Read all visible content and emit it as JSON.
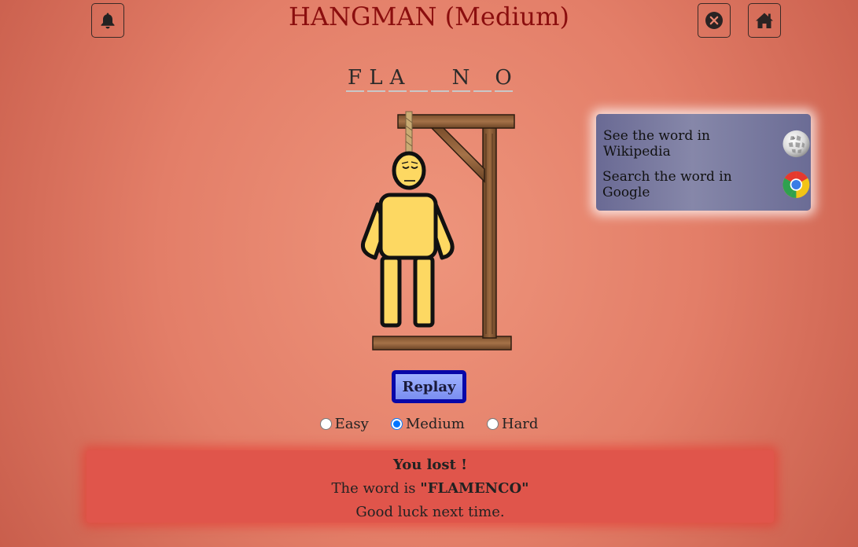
{
  "header": {
    "title": "HANGMAN (Medium)",
    "bell_icon": "bell-icon",
    "close_icon": "close-circle-icon",
    "home_icon": "home-icon"
  },
  "word_slots": [
    "F",
    "L",
    "A",
    "",
    "",
    "N",
    "",
    "O"
  ],
  "links": {
    "wikipedia_label": "See the word in Wikipedia",
    "wikipedia_icon": "wikipedia-globe-icon",
    "google_label": "Search the word in Google",
    "google_icon": "chrome-icon"
  },
  "replay_label": "Replay",
  "difficulty": {
    "options": [
      "Easy",
      "Medium",
      "Hard"
    ],
    "selected": "Medium"
  },
  "result": {
    "title": "You lost !",
    "word_prefix": "The word is ",
    "word": "\"FLAMENCO\"",
    "message": "Good luck next time."
  },
  "colors": {
    "title": "#8b0e0e",
    "replay_border": "#0707a8",
    "result_bg": "#e0554b",
    "figure": "#fdd862"
  }
}
